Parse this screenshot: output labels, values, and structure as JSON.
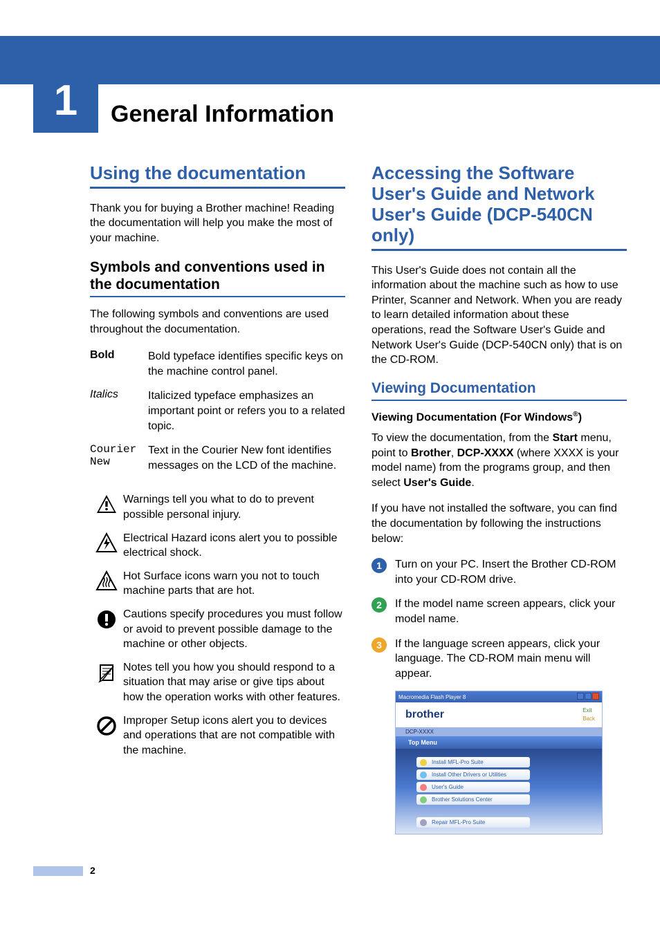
{
  "chapter": {
    "number": "1",
    "title": "General Information"
  },
  "left": {
    "h1": "Using the documentation",
    "intro": "Thank you for buying a Brother machine! Reading the documentation will help you make the most of your machine.",
    "h2": "Symbols and conventions used in the documentation",
    "p2": "The following symbols and conventions are used throughout the documentation.",
    "conv": [
      {
        "term": "Bold",
        "cls": "bold",
        "desc": "Bold typeface identifies specific keys on the machine control panel."
      },
      {
        "term": "Italics",
        "cls": "italic",
        "desc": "Italicized typeface emphasizes an important point or refers you to a related topic."
      },
      {
        "term": "Courier New",
        "cls": "mono",
        "desc": "Text in the Courier New font identifies messages on the LCD of the machine."
      }
    ],
    "icons": [
      {
        "key": "warning",
        "desc": "Warnings tell you what to do to prevent possible personal injury."
      },
      {
        "key": "electrical",
        "desc": "Electrical Hazard icons alert you to possible electrical shock."
      },
      {
        "key": "hotsurface",
        "desc": "Hot Surface icons warn you not to touch machine parts that are hot."
      },
      {
        "key": "caution",
        "desc": "Cautions specify procedures you must follow or avoid to prevent possible damage to the machine or other objects."
      },
      {
        "key": "note",
        "desc": "Notes tell you how you should respond to a situation that may arise or give tips about how the operation works with other features."
      },
      {
        "key": "improper",
        "desc": "Improper Setup icons alert you to devices and operations that are not compatible with the machine."
      }
    ]
  },
  "right": {
    "h1": "Accessing the Software User's Guide and Network User's Guide (DCP-540CN only)",
    "p1": "This User's Guide does not contain all the information about the machine such as how to use Printer, Scanner and Network. When you are ready to learn detailed information about these operations, read the Software User's Guide and Network User's Guide (DCP-540CN only) that is on the CD-ROM.",
    "h3": "Viewing Documentation",
    "h4_prefix": "Viewing Documentation (For Windows",
    "h4_suffix": ")",
    "p2_parts": [
      "To view the documentation, from the ",
      "Start",
      " menu, point to ",
      "Brother",
      ", ",
      "DCP-XXXX",
      " (where XXXX is your model name) from the programs group, and then select ",
      "User's Guide",
      "."
    ],
    "p3": "If you have not installed the software, you can find the documentation by following the instructions below:",
    "steps": [
      {
        "n": "1",
        "color": "#2e5fa9",
        "desc": "Turn on your PC. Insert the Brother CD-ROM into your CD-ROM drive."
      },
      {
        "n": "2",
        "color": "#2fa151",
        "desc": "If the model name screen appears, click your model name."
      },
      {
        "n": "3",
        "color": "#f0a52b",
        "desc": "If the language screen appears, click your language. The CD-ROM main menu will appear."
      }
    ],
    "screenshot": {
      "titlebar": "Macromedia Flash Player 8",
      "brand": "brother",
      "exit": "Exit",
      "back": "Back",
      "model": "DCP-XXXX",
      "topmenu": "Top Menu",
      "items": [
        "Install MFL-Pro Suite",
        "Install Other Drivers or Utilities",
        "User's Guide",
        "Brother Solutions Center"
      ],
      "repair": "Repair MFL-Pro Suite"
    }
  },
  "pagenum": "2"
}
